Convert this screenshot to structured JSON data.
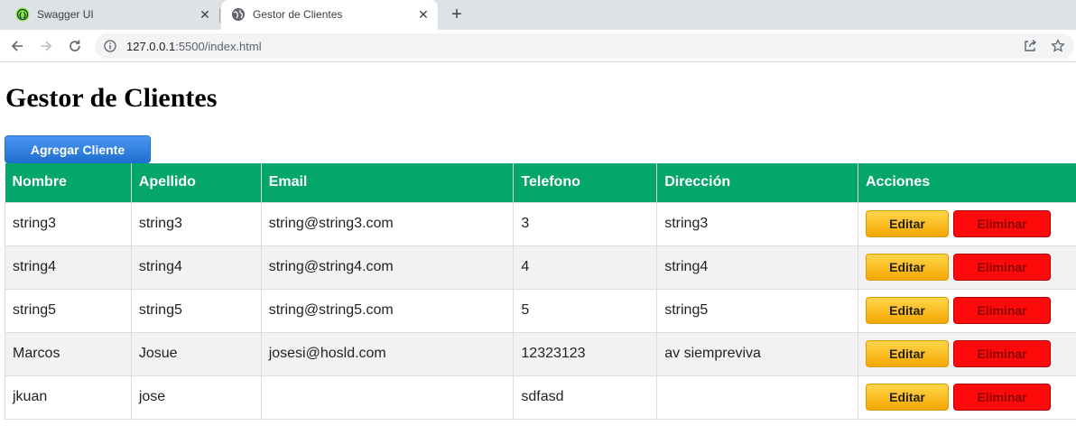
{
  "browser": {
    "tabs": [
      {
        "title": "Swagger UI",
        "icon": "swagger-icon",
        "active": false
      },
      {
        "title": "Gestor de Clientes",
        "icon": "globe-icon",
        "active": true
      }
    ],
    "close_glyph": "✕",
    "new_tab_glyph": "+",
    "url_host": "127.0.0.1",
    "url_rest": ":5500/index.html"
  },
  "page": {
    "title": "Gestor de Clientes",
    "add_button": "Agregar Cliente"
  },
  "table": {
    "headers": [
      "Nombre",
      "Apellido",
      "Email",
      "Telefono",
      "Dirección",
      "Acciones"
    ],
    "edit_label": "Editar",
    "delete_label": "Eliminar",
    "rows": [
      {
        "nombre": "string3",
        "apellido": "string3",
        "email": "string@string3.com",
        "telefono": "3",
        "direccion": "string3"
      },
      {
        "nombre": "string4",
        "apellido": "string4",
        "email": "string@string4.com",
        "telefono": "4",
        "direccion": "string4"
      },
      {
        "nombre": "string5",
        "apellido": "string5",
        "email": "string@string5.com",
        "telefono": "5",
        "direccion": "string5"
      },
      {
        "nombre": "Marcos",
        "apellido": "Josue",
        "email": "josesi@hosld.com",
        "telefono": "12323123",
        "direccion": "av siempreviva"
      },
      {
        "nombre": "jkuan",
        "apellido": "jose",
        "email": "",
        "telefono": "sdfasd",
        "direccion": ""
      }
    ]
  },
  "colors": {
    "header_green": "#04a66c",
    "add_button_blue": "#1f6fd1",
    "edit_yellow": "#f5a800",
    "delete_red": "#ff0a0a"
  }
}
